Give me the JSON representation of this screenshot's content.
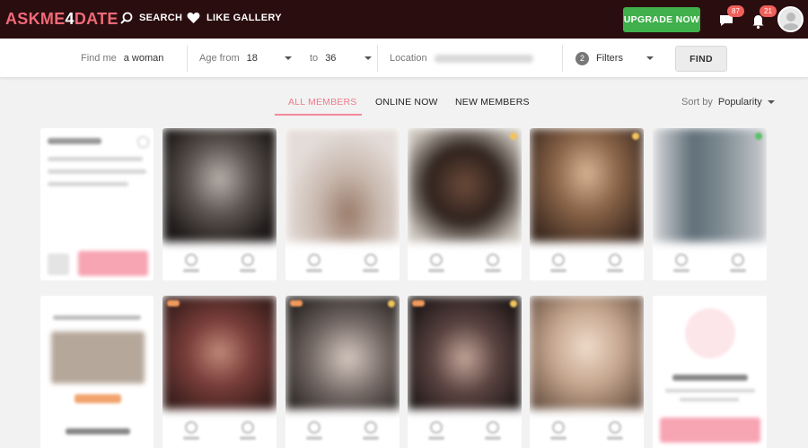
{
  "header": {
    "logo_prefix": "ASKME",
    "logo_digit": "4",
    "logo_suffix": "DATE",
    "search_label": "SEARCH",
    "gallery_label": "LIKE GALLERY",
    "upgrade_label": "UPGRADE NOW",
    "messages_count": "87",
    "notifications_count": "21",
    "brand_color": "#f06a78",
    "upgrade_color": "#3fb04b"
  },
  "search": {
    "find_label": "Find me",
    "find_value": "a woman",
    "age_from_label": "Age from",
    "age_from_value": "18",
    "age_to_label": "to",
    "age_to_value": "36",
    "location_label": "Location",
    "filters_count": "2",
    "filters_label": "Filters",
    "find_button": "FIND"
  },
  "tabs": {
    "all": "ALL MEMBERS",
    "online": "ONLINE NOW",
    "new": "NEW MEMBERS",
    "active": "all"
  },
  "sort": {
    "label": "Sort by",
    "value": "Popularity"
  }
}
